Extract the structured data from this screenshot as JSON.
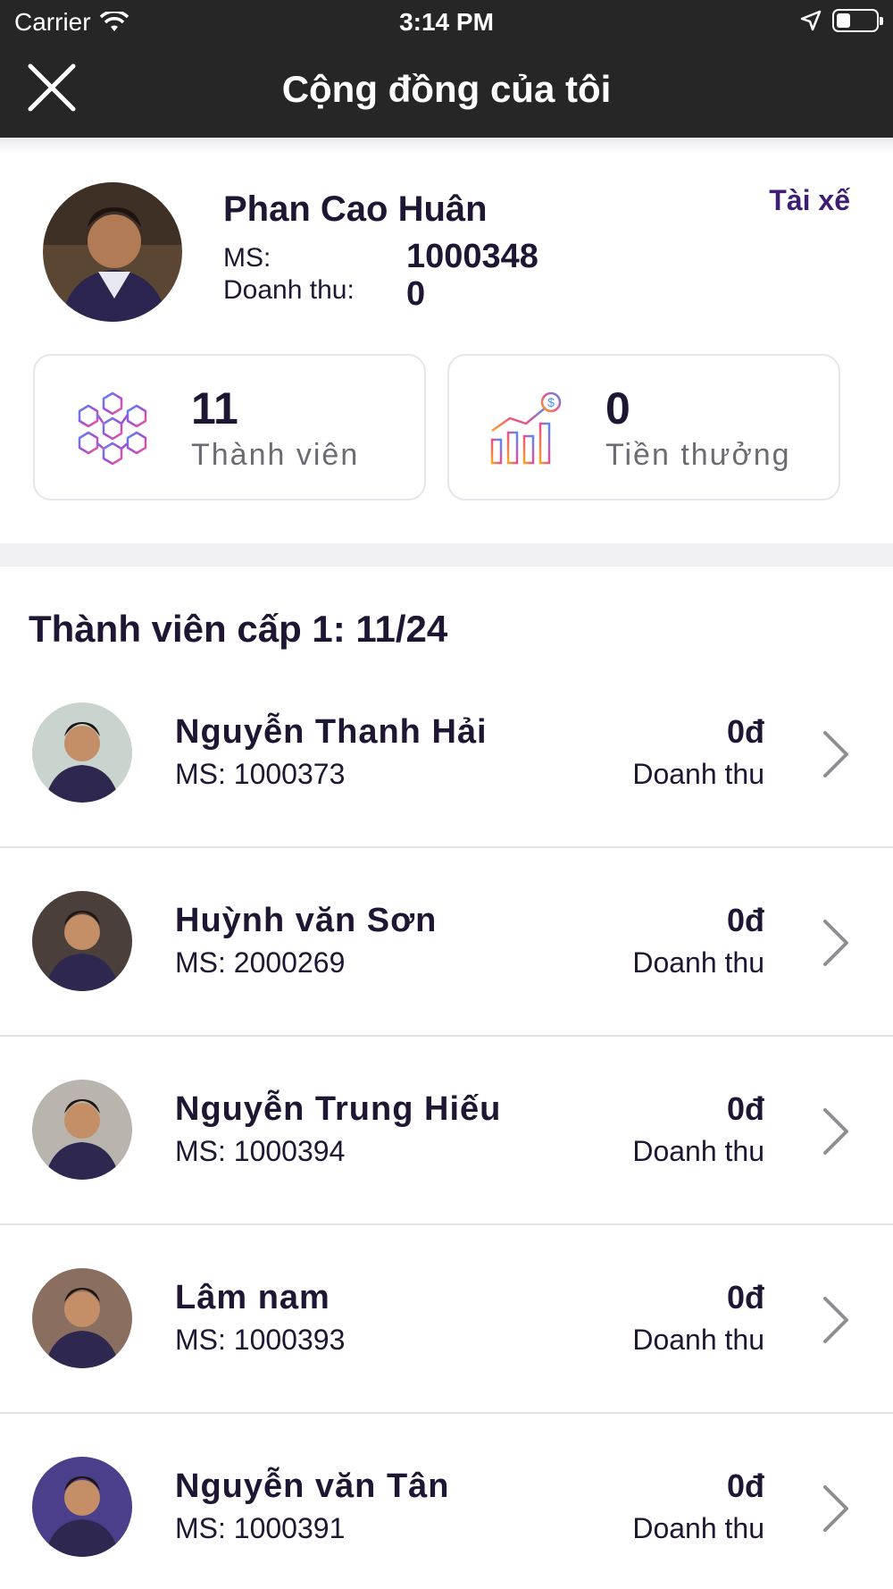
{
  "status_bar": {
    "carrier": "Carrier",
    "time": "3:14 PM",
    "battery_level": 0.35
  },
  "nav": {
    "title": "Cộng đồng của tôi",
    "close_icon": "close-icon"
  },
  "profile": {
    "name": "Phan Cao Huân",
    "role": "Tài xế",
    "id_label": "MS:",
    "id_value": "1000348",
    "revenue_label": "Doanh thu:",
    "revenue_value": "0"
  },
  "stats": {
    "members": {
      "value": "11",
      "label": "Thành viên",
      "icon": "network-cubes-icon"
    },
    "bonus": {
      "value": "0",
      "label": "Tiền thưởng",
      "icon": "growth-chart-icon"
    }
  },
  "section": {
    "title": "Thành viên cấp 1: 11/24"
  },
  "members": [
    {
      "name": "Nguyễn Thanh Hải",
      "id": "MS: 1000373",
      "amount": "0đ",
      "amount_label": "Doanh thu",
      "avatar_color": "#c9d4cf"
    },
    {
      "name": "Huỳnh văn Sơn",
      "id": "MS: 2000269",
      "amount": "0đ",
      "amount_label": "Doanh thu",
      "avatar_color": "#4a3f3a"
    },
    {
      "name": "Nguyễn Trung Hiếu",
      "id": "MS: 1000394",
      "amount": "0đ",
      "amount_label": "Doanh thu",
      "avatar_color": "#b9b4ad"
    },
    {
      "name": "Lâm nam",
      "id": "MS: 1000393",
      "amount": "0đ",
      "amount_label": "Doanh thu",
      "avatar_color": "#8a6f60"
    },
    {
      "name": "Nguyễn văn Tân",
      "id": "MS: 1000391",
      "amount": "0đ",
      "amount_label": "Doanh thu",
      "avatar_color": "#4b3f8c"
    }
  ]
}
